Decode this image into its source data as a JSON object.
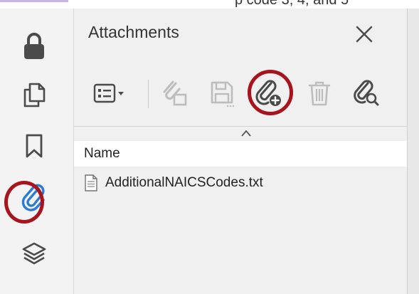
{
  "top_strip": {
    "cut_text": "p code 3, 4, and 5"
  },
  "rail": {
    "items": [
      {
        "name": "lock",
        "icon": "lock-icon"
      },
      {
        "name": "pages",
        "icon": "copy-pages-icon"
      },
      {
        "name": "bookmarks",
        "icon": "bookmark-icon"
      },
      {
        "name": "attachments",
        "icon": "paperclip-icon",
        "active": true,
        "highlighted": true
      },
      {
        "name": "layers",
        "icon": "layers-icon"
      }
    ]
  },
  "panel": {
    "title": "Attachments",
    "close_icon": "close-icon",
    "toolbar": [
      {
        "name": "options-menu",
        "icon": "list-options-icon",
        "enabled": true
      },
      {
        "name": "open-attachment",
        "icon": "open-file-icon",
        "enabled": false
      },
      {
        "name": "save-attachment",
        "icon": "save-icon",
        "enabled": false
      },
      {
        "name": "add-attachment",
        "icon": "add-attachment-icon",
        "enabled": true,
        "highlighted": true
      },
      {
        "name": "delete-attachment",
        "icon": "trash-icon",
        "enabled": false
      },
      {
        "name": "search-attachment",
        "icon": "search-attachment-icon",
        "enabled": true
      }
    ],
    "list": {
      "column_name": "Name",
      "files": [
        {
          "name": "AdditionalNAICSCodes.txt",
          "icon": "text-file-icon"
        }
      ]
    }
  },
  "colors": {
    "highlight_ring": "#a8131c",
    "active_icon": "#2a7bd6",
    "enabled_icon": "#4a4a4a",
    "disabled_icon": "#bdbdbd"
  }
}
